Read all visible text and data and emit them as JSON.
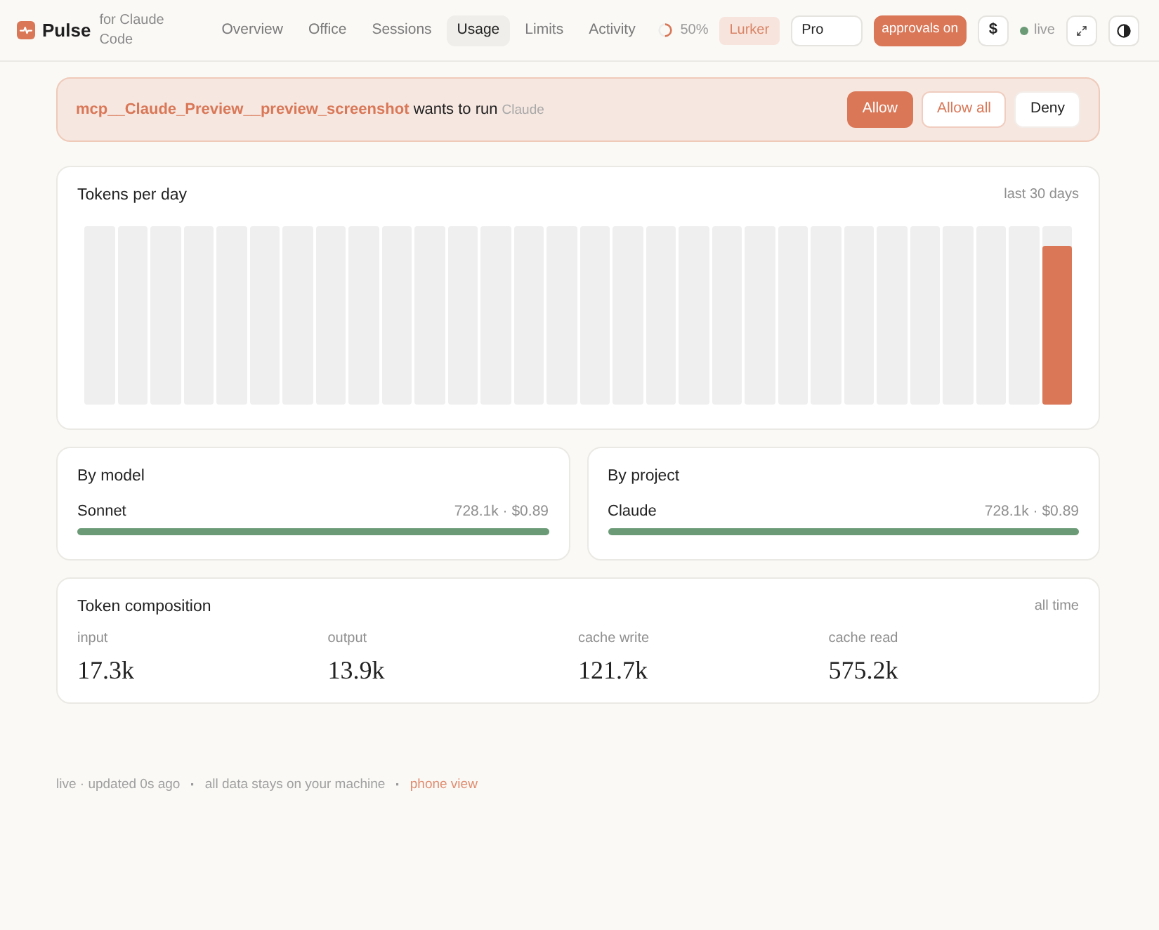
{
  "header": {
    "brand": "Pulse",
    "tagline": "for Claude Code",
    "nav": [
      {
        "label": "Overview",
        "selected": false
      },
      {
        "label": "Office",
        "selected": false
      },
      {
        "label": "Sessions",
        "selected": false
      },
      {
        "label": "Usage",
        "selected": true
      },
      {
        "label": "Limits",
        "selected": false
      },
      {
        "label": "Activity",
        "selected": false
      }
    ],
    "usage_ring": {
      "level": 0.5,
      "reading": "50%"
    },
    "badge": "Lurker",
    "plan_select": {
      "value": "Pro"
    },
    "approvals": {
      "label": "approvals on",
      "on": true
    },
    "currency_button": "$",
    "live": {
      "label": "live",
      "on": true
    }
  },
  "approval_banner": {
    "tool": "mcp__Claude_Preview__preview_screenshot",
    "message": "wants to run",
    "source": "Claude",
    "buttons": [
      {
        "label": "Allow",
        "kind": "primary"
      },
      {
        "label": "Allow all",
        "kind": "outline"
      },
      {
        "label": "Deny",
        "kind": "plain"
      }
    ]
  },
  "tokens_per_day": {
    "title": "Tokens per day",
    "range": "last 30 days"
  },
  "breakdowns": [
    {
      "title": "By model",
      "rows": [
        {
          "name": "Sonnet",
          "reading": "728.1k · $0.89",
          "level": 1
        }
      ]
    },
    {
      "title": "By project",
      "rows": [
        {
          "name": "Claude",
          "reading": "728.1k · $0.89",
          "level": 1
        }
      ]
    }
  ],
  "composition": {
    "title": "Token composition",
    "range": "all time",
    "stats": [
      {
        "label": "input",
        "value": "17.3k"
      },
      {
        "label": "output",
        "value": "13.9k"
      },
      {
        "label": "cache write",
        "value": "121.7k"
      },
      {
        "label": "cache read",
        "value": "575.2k"
      }
    ]
  },
  "footer": [
    {
      "kind": "text",
      "text": "live · updated 0s ago"
    },
    {
      "kind": "separator",
      "text": "·"
    },
    {
      "kind": "text",
      "text": "all data stays on your machine"
    },
    {
      "kind": "separator",
      "text": "·"
    },
    {
      "kind": "link",
      "text": "phone view"
    }
  ]
}
